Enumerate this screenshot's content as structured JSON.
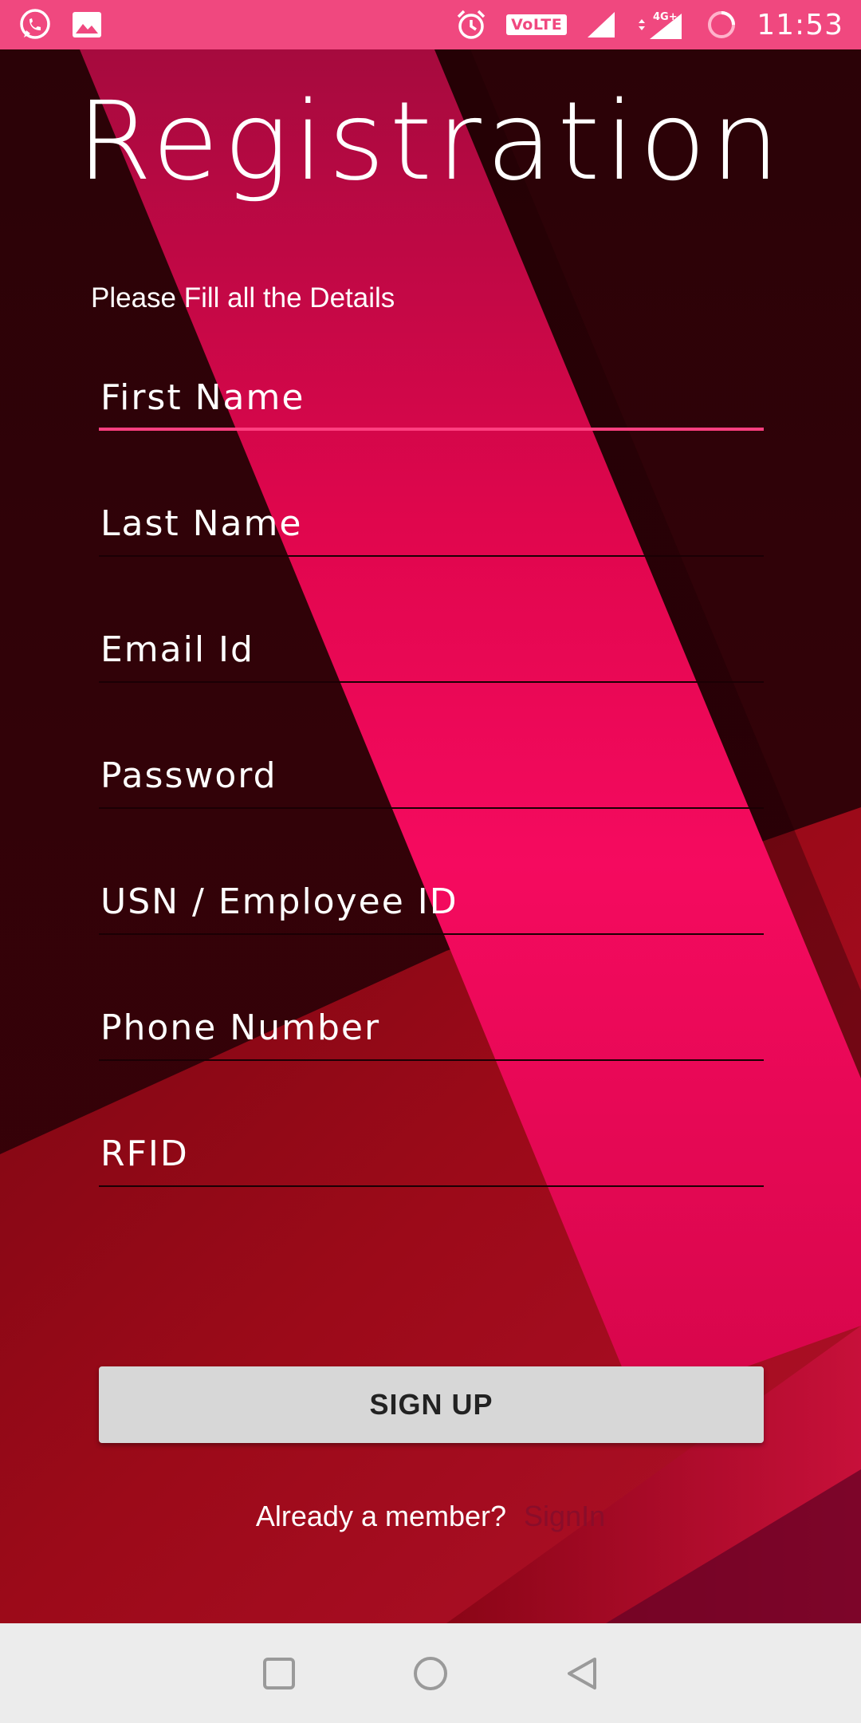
{
  "status_bar": {
    "time": "11:53",
    "volte_label": "VoLTE",
    "network_label": "4G+",
    "icons": [
      "whatsapp-icon",
      "image-icon",
      "alarm-icon",
      "volte-icon",
      "signal-icon",
      "network-icon",
      "loading-icon"
    ]
  },
  "form": {
    "title": "Registration",
    "subtitle": "Please Fill all the Details",
    "fields": [
      {
        "placeholder": "First Name",
        "value": ""
      },
      {
        "placeholder": "Last Name",
        "value": ""
      },
      {
        "placeholder": "Email Id",
        "value": ""
      },
      {
        "placeholder": "Password",
        "value": ""
      },
      {
        "placeholder": "USN / Employee ID",
        "value": ""
      },
      {
        "placeholder": "Phone Number",
        "value": ""
      },
      {
        "placeholder": "RFID",
        "value": ""
      }
    ],
    "signup_label": "SIGN UP",
    "member_text": "Already a member?",
    "signin_label": "SignIn"
  },
  "nav_bar": {
    "buttons": [
      "recents-icon",
      "home-icon",
      "back-icon"
    ]
  },
  "colors": {
    "status_bar": "#f0487f",
    "accent": "#ff3f80",
    "button_bg": "#d7d7d7",
    "signin_link": "#8a0d2a",
    "nav_bar": "#ececec"
  }
}
